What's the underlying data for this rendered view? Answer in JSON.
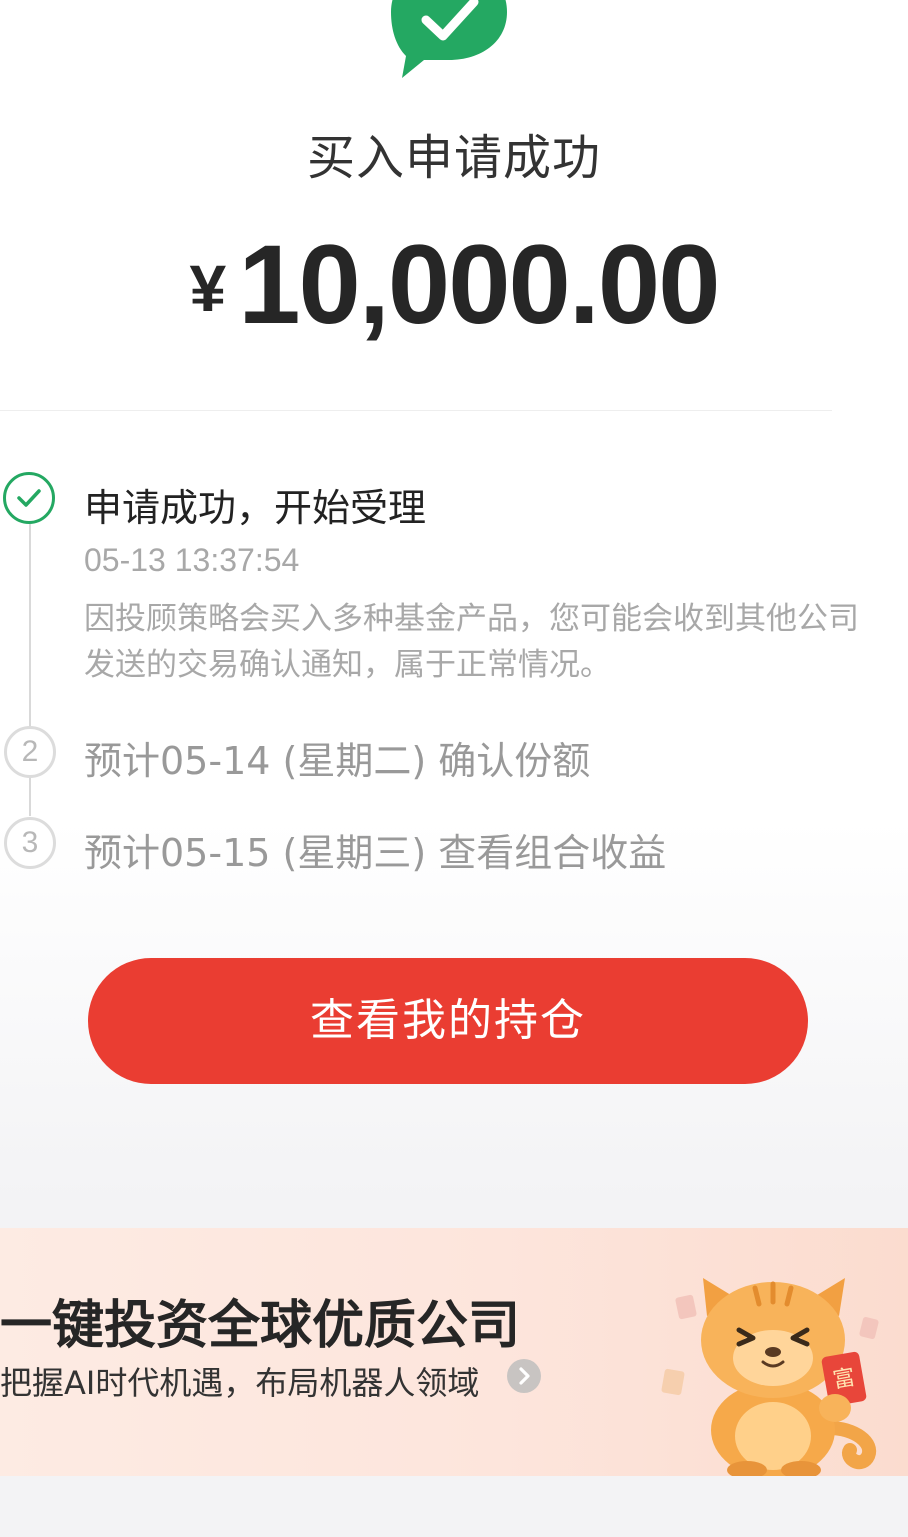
{
  "header": {
    "title": "买入申请成功",
    "currency_symbol": "¥",
    "amount": "10,000.00"
  },
  "timeline": {
    "steps": [
      {
        "status": "done",
        "title": "申请成功，开始受理",
        "time": "05-13 13:37:54",
        "description": "因投顾策略会买入多种基金产品，您可能会收到其他公司发送的交易确认通知，属于正常情况。"
      },
      {
        "status": "pending",
        "number": "2",
        "title": "预计05-14 (星期二) 确认份额"
      },
      {
        "status": "pending",
        "number": "3",
        "title": "预计05-15 (星期三) 查看组合收益"
      }
    ]
  },
  "cta": {
    "label": "查看我的持仓"
  },
  "banner": {
    "title": "一键投资全球优质公司",
    "subtitle": "把握AI时代机遇，布局机器人领域",
    "arrow_icon": "chevron-right-circle-icon",
    "mascot_icon": "mascot-cat-icon",
    "mascot_card_text": "富"
  },
  "colors": {
    "success_green": "#24a862",
    "cta_red": "#ea3d32",
    "muted_text": "#a8a8a8"
  }
}
